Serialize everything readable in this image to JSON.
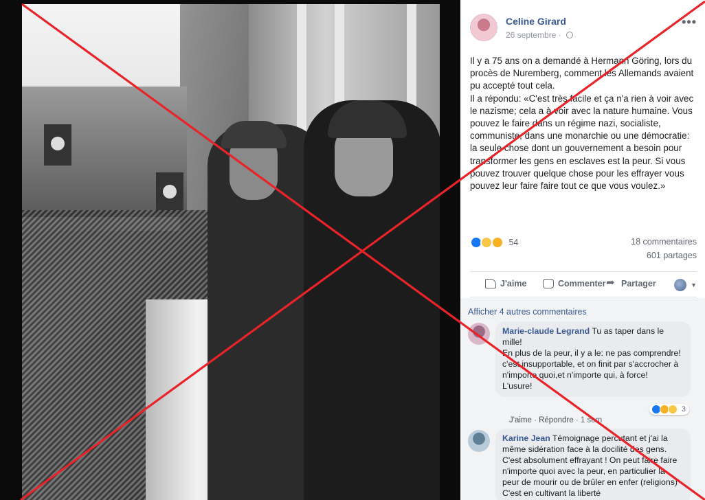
{
  "post": {
    "author": "Celine Girard",
    "date": "26 septembre",
    "privacy_icon": "globe-icon",
    "more_label": "•••",
    "paragraphs": [
      "Il y a 75 ans on a demandé à Hermann Göring, lors du procès de Nuremberg, comment les Allemands avaient pu accepté tout cela.",
      "Il a répondu: «C'est très facile et ça n'a rien à voir avec le nazisme; cela a à voir avec la nature humaine. Vous pouvez le faire dans un régime nazi, socialiste, communiste, dans une monarchie ou une démocratie: la seule chose dont un gouvernement a besoin pour transformer les gens en esclaves est la peur. Si vous pouvez trouver quelque chose pour les effrayer vous pouvez leur faire faire tout ce que vous voulez.»"
    ],
    "reaction_count": "54",
    "comments_count": "18 commentaires",
    "shares_count": "601 partages"
  },
  "actions": {
    "like": "J'aime",
    "comment": "Commenter",
    "share": "Partager"
  },
  "comments": {
    "see_more": "Afficher 4 autres commentaires",
    "items": [
      {
        "author": "Marie-claude Legrand",
        "lines": [
          "Tu as taper dans le mille!",
          "En plus de la peur, il y a le: ne pas comprendre! c'est insupportable, et on finit par s'accrocher à n'importe quoi,et n'importe qui, à force!",
          "L'usure!"
        ],
        "like": "J'aime",
        "reply": "Répondre",
        "time": "1 sem",
        "reaction_count": "3"
      },
      {
        "author": "Karine Jean",
        "lines": [
          "Témoignage percutant et j'ai la même sidération face à la docilité des gens. C'est absolument effrayant ! On peut faire faire n'importe quoi avec la peur, en particulier la peur de mourir ou de brûler en enfer (religions) C'est en cultivant la liberté"
        ]
      }
    ]
  },
  "colors": {
    "x_mark": "#e8232a",
    "link": "#385898",
    "like_blue": "#1877f2"
  }
}
